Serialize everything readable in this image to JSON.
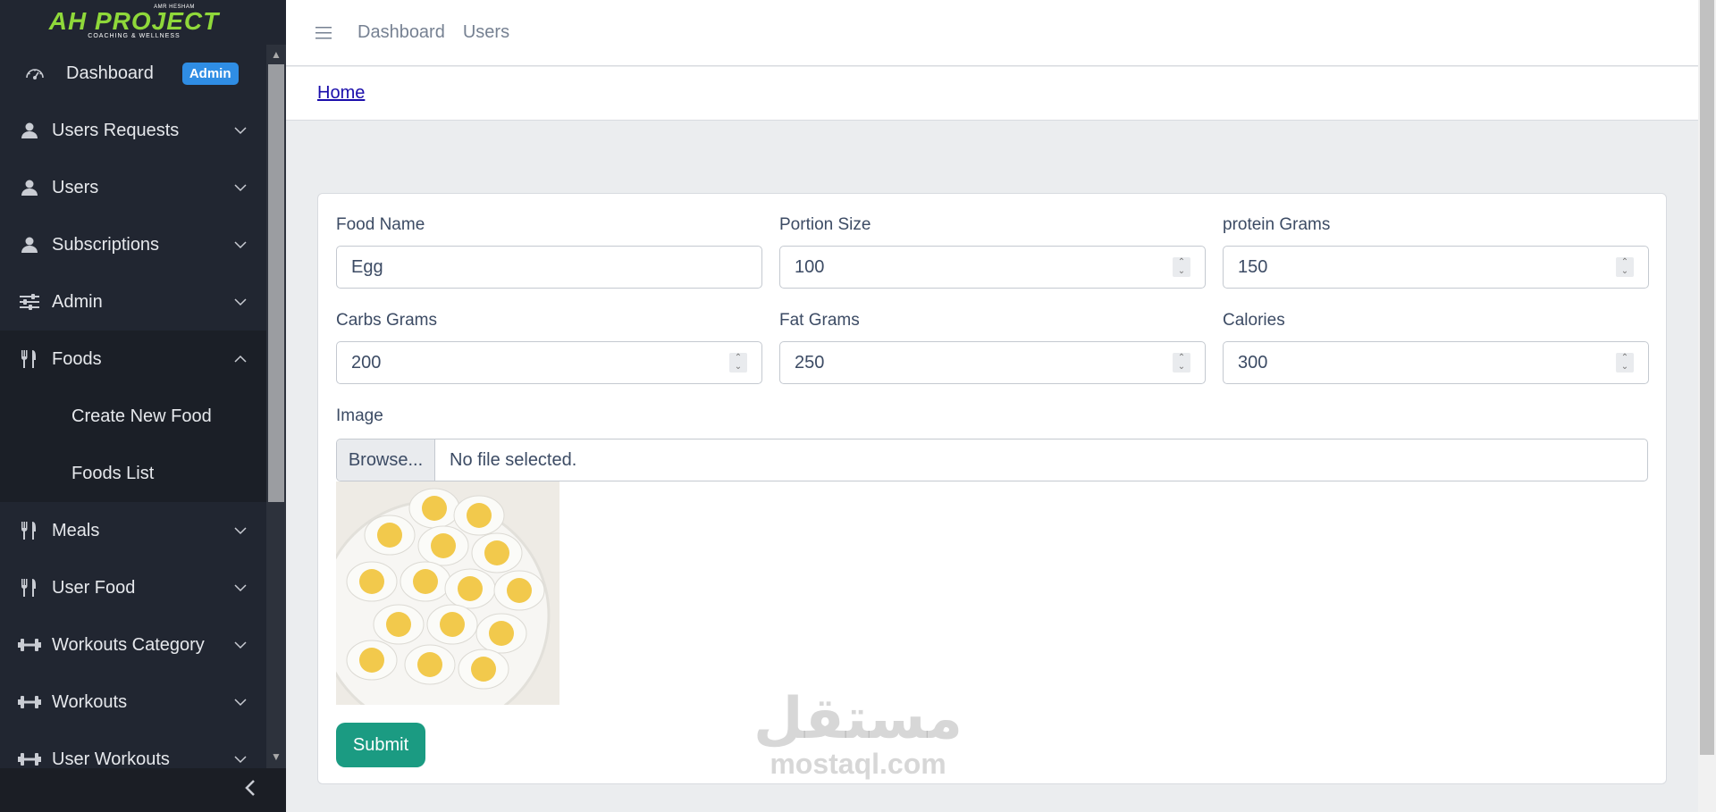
{
  "brand": {
    "tiny": "AMR HESHAM",
    "name": "AH PROJECT",
    "tagline": "COACHING & WELLNESS"
  },
  "sidebar": {
    "dashboard": {
      "label": "Dashboard",
      "badge": "Admin"
    },
    "items": [
      {
        "label": "Users Requests",
        "icon": "user-icon"
      },
      {
        "label": "Users",
        "icon": "user-icon"
      },
      {
        "label": "Subscriptions",
        "icon": "user-icon"
      },
      {
        "label": "Admin",
        "icon": "sliders-icon"
      },
      {
        "label": "Foods",
        "icon": "utensils-icon",
        "expanded": true,
        "children": [
          "Create New Food",
          "Foods List"
        ]
      },
      {
        "label": "Meals",
        "icon": "utensils-icon"
      },
      {
        "label": "User Food",
        "icon": "utensils-icon"
      },
      {
        "label": "Workouts Category",
        "icon": "dumbbell-icon"
      },
      {
        "label": "Workouts",
        "icon": "dumbbell-icon"
      },
      {
        "label": "User Workouts",
        "icon": "dumbbell-icon"
      }
    ]
  },
  "header": {
    "links": [
      "Dashboard",
      "Users"
    ],
    "breadcrumb": "Home"
  },
  "form": {
    "food_name": {
      "label": "Food Name",
      "value": "Egg"
    },
    "portion_size": {
      "label": "Portion Size",
      "value": "100"
    },
    "protein": {
      "label": "protein Grams",
      "value": "150"
    },
    "carbs": {
      "label": "Carbs Grams",
      "value": "200"
    },
    "fat": {
      "label": "Fat Grams",
      "value": "250"
    },
    "calories": {
      "label": "Calories",
      "value": "300"
    },
    "image": {
      "label": "Image",
      "browse": "Browse...",
      "status": "No file selected."
    },
    "submit": "Submit"
  },
  "watermark": {
    "arabic": "مستقل",
    "latin": "mostaql.com"
  },
  "colors": {
    "sidebar": "#212631",
    "accent_badge": "#2f8de4",
    "submit": "#1b9b82"
  }
}
